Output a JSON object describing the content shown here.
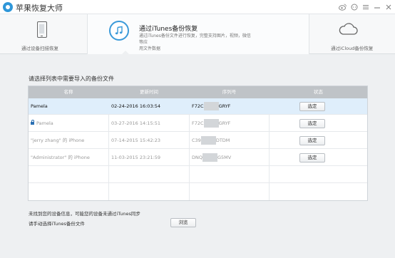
{
  "app": {
    "title": "苹果恢复大师"
  },
  "modes": {
    "device": {
      "label": "通过设备扫描恢复"
    },
    "itunes": {
      "title": "通过iTunes备份恢复",
      "desc_line1": "通过iTunes备份文件进行恢复，完整支持图片，视频，微信等应",
      "desc_line2": "用文件数据"
    },
    "icloud": {
      "label": "通过iCloud备份恢复"
    }
  },
  "panel": {
    "title": "请选择列表中需要导入的备份文件"
  },
  "table": {
    "columns": [
      "名称",
      "更新时间",
      "序列号",
      "状态"
    ],
    "rows": [
      {
        "name": "Pamela",
        "time": "02-24-2016 16:03:54",
        "serial_prefix": "F72C",
        "serial_suffix": "GRYF",
        "action": "选定",
        "locked": false,
        "selected": true
      },
      {
        "name": "Pamela",
        "time": "03-27-2016 14:15:51",
        "serial_prefix": "F72C",
        "serial_suffix": "GRYF",
        "action": "选定",
        "locked": true,
        "selected": false
      },
      {
        "name": "\"jerry zhang\" 的 iPhone",
        "time": "07-14-2015 15:42:23",
        "serial_prefix": "C39",
        "serial_suffix": "DTDM",
        "action": "选定",
        "locked": false,
        "selected": false
      },
      {
        "name": "\"Administrator\" 的 iPhone",
        "time": "11-03-2015 23:21:59",
        "serial_prefix": "DNQ",
        "serial_suffix": "G5MV",
        "action": "选定",
        "locked": false,
        "selected": false
      }
    ]
  },
  "footer": {
    "hint1": "未找到您的设备信息，可能您的设备未通过iTunes同步",
    "hint2": "请手动选择iTunes备份文件",
    "browse_label": "浏览"
  },
  "colors": {
    "accent": "#3a9ad9",
    "header_bg": "#bfc3c7",
    "selected_row": "#dfeefb"
  }
}
